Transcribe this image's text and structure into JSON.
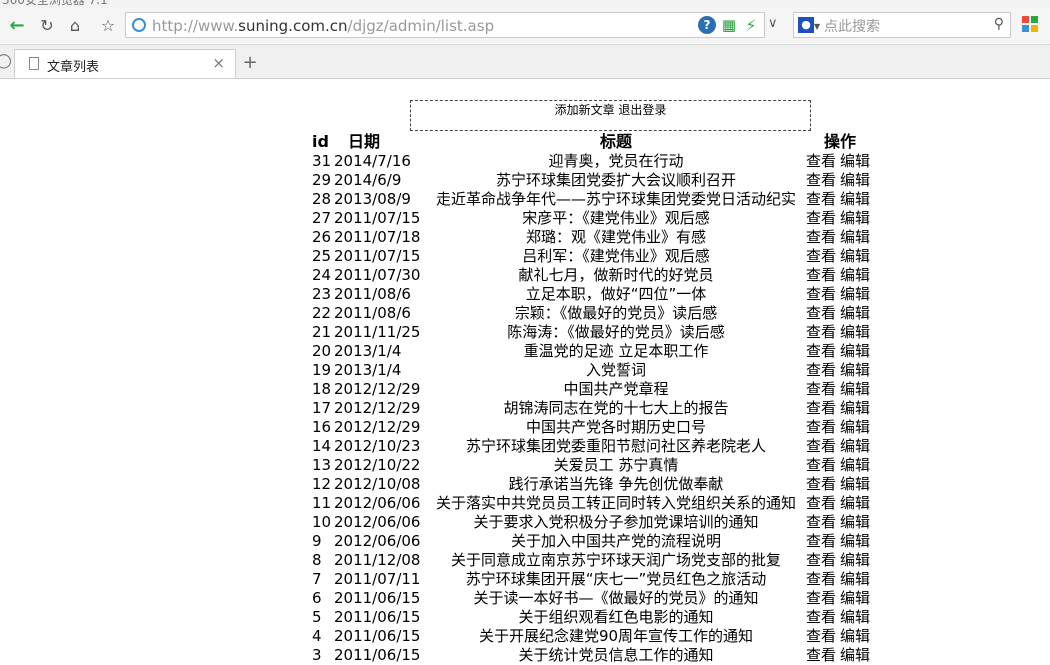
{
  "browser": {
    "window_title": "360安全浏览器 7.1",
    "url_prefix": "http://www.",
    "url_host": "suning.com.cn",
    "url_path": "/djgz/admin/list.asp",
    "search_placeholder": "点此搜索",
    "tab_title": "文章列表",
    "new_tab_label": "+"
  },
  "page": {
    "add_link": "添加新文章",
    "logout_link": "退出登录",
    "headers": {
      "id": "id",
      "date": "日期",
      "title": "标题",
      "actions": "操作"
    },
    "view_label": "查看",
    "edit_label": "编辑",
    "rows": [
      {
        "id": "31",
        "date": "2014/7/16",
        "title": "迎青奥，党员在行动"
      },
      {
        "id": "29",
        "date": "2014/6/9",
        "title": "苏宁环球集团党委扩大会议顺利召开"
      },
      {
        "id": "28",
        "date": "2013/08/9",
        "title": "走近革命战争年代——苏宁环球集团党委党日活动纪实"
      },
      {
        "id": "27",
        "date": "2011/07/15",
        "title": "宋彦平：《建党伟业》观后感"
      },
      {
        "id": "26",
        "date": "2011/07/18",
        "title": "郑璐：观《建党伟业》有感"
      },
      {
        "id": "25",
        "date": "2011/07/15",
        "title": "吕利军：《建党伟业》观后感"
      },
      {
        "id": "24",
        "date": "2011/07/30",
        "title": "献礼七月，做新时代的好党员"
      },
      {
        "id": "23",
        "date": "2011/08/6",
        "title": "立足本职，做好“四位”一体"
      },
      {
        "id": "22",
        "date": "2011/08/6",
        "title": "宗颖：《做最好的党员》读后感"
      },
      {
        "id": "21",
        "date": "2011/11/25",
        "title": "陈海涛：《做最好的党员》读后感"
      },
      {
        "id": "20",
        "date": "2013/1/4",
        "title": "重温党的足迹 立足本职工作"
      },
      {
        "id": "19",
        "date": "2013/1/4",
        "title": "入党誓词"
      },
      {
        "id": "18",
        "date": "2012/12/29",
        "title": "中国共产党章程"
      },
      {
        "id": "17",
        "date": "2012/12/29",
        "title": "胡锦涛同志在党的十七大上的报告"
      },
      {
        "id": "16",
        "date": "2012/12/29",
        "title": "中国共产党各时期历史口号"
      },
      {
        "id": "14",
        "date": "2012/10/23",
        "title": "苏宁环球集团党委重阳节慰问社区养老院老人"
      },
      {
        "id": "13",
        "date": "2012/10/22",
        "title": "关爱员工 苏宁真情"
      },
      {
        "id": "12",
        "date": "2012/10/08",
        "title": "践行承诺当先锋 争先创优做奉献"
      },
      {
        "id": "11",
        "date": "2012/06/06",
        "title": "关于落实中共党员员工转正同时转入党组织关系的通知"
      },
      {
        "id": "10",
        "date": "2012/06/06",
        "title": "关于要求入党积极分子参加党课培训的通知"
      },
      {
        "id": "9",
        "date": "2012/06/06",
        "title": "关于加入中国共产党的流程说明"
      },
      {
        "id": "8",
        "date": "2011/12/08",
        "title": "关于同意成立南京苏宁环球天润广场党支部的批复"
      },
      {
        "id": "7",
        "date": "2011/07/11",
        "title": "苏宁环球集团开展“庆七一”党员红色之旅活动"
      },
      {
        "id": "6",
        "date": "2011/06/15",
        "title": "关于读一本好书—《做最好的党员》的通知"
      },
      {
        "id": "5",
        "date": "2011/06/15",
        "title": "关于组织观看红色电影的通知"
      },
      {
        "id": "4",
        "date": "2011/06/15",
        "title": "关于开展纪念建党90周年宣传工作的通知"
      },
      {
        "id": "3",
        "date": "2011/06/15",
        "title": "关于统计党员信息工作的通知"
      }
    ]
  },
  "colors": {
    "back_arrow": "#2aa642",
    "search_engine": "#1d4fbf",
    "help_icon": "#2a6fb3"
  }
}
